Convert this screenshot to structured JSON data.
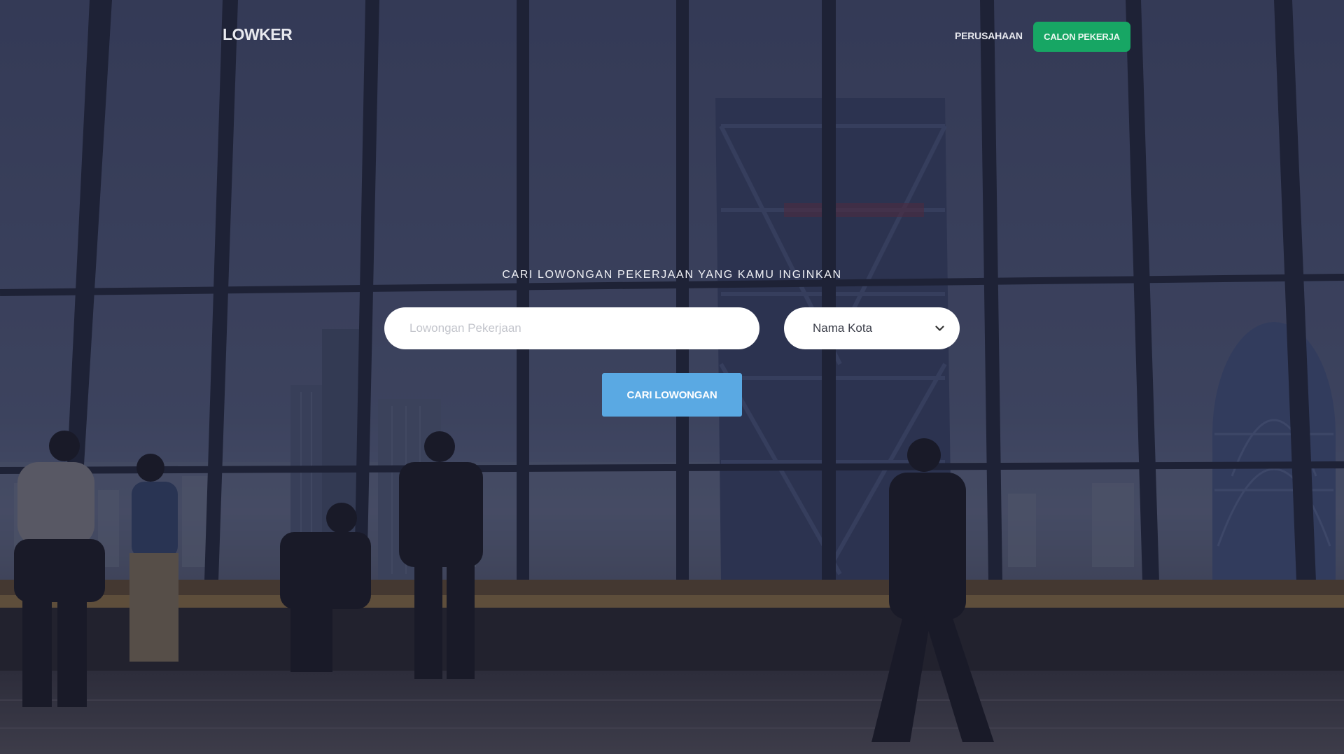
{
  "navbar": {
    "brand": "LOWKER",
    "link_company": "PERUSAHAAN",
    "cta_job_seeker": "CALON PEKERJA"
  },
  "hero": {
    "tagline": "CARI LOWONGAN PEKERJAAN YANG KAMU INGINKAN",
    "search_placeholder": "Lowongan Pekerjaan",
    "search_value": "",
    "city_selected": "Nama Kota",
    "search_button": "CARI LOWONGAN"
  },
  "icons": {
    "city_dropdown": "chevron-down-icon"
  },
  "colors": {
    "cta_green": "#17a664",
    "search_button_blue": "#5aa9e3",
    "overlay": "#1a1c30"
  }
}
